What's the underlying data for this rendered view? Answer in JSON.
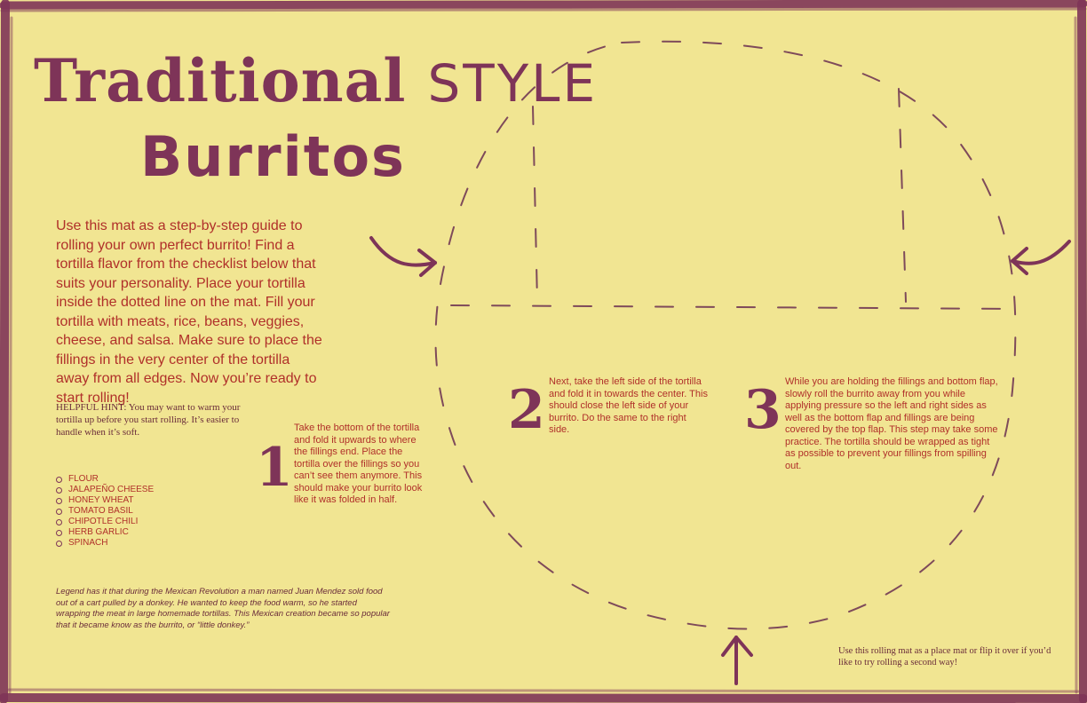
{
  "title": {
    "line1_main": "Traditional",
    "line1_style": "STYLE",
    "line2": "Burritos"
  },
  "intro": "Use this mat as a step-by-step guide to rolling your own perfect burrito! Find a tortilla flavor from the checklist below that suits your personality. Place your tortilla inside the dotted line on the mat. Fill your tortilla with meats, rice, beans, veggies, cheese, and salsa. Make sure to place the fillings in the very center of the tortilla away from all edges. Now you’re ready to start rolling!",
  "hint": "HELPFUL HINT: You may want to warm your tortilla up before you start rolling. It’s easier to handle when it’s soft.",
  "flavors": [
    "FLOUR",
    "JALAPEÑO CHEESE",
    "HONEY WHEAT",
    "TOMATO BASIL",
    "CHIPOTLE CHILI",
    "HERB GARLIC",
    "SPINACH"
  ],
  "legend": "Legend has it that during the Mexican Revolution a man named Juan Mendez sold food out of a cart pulled by a donkey. He wanted to keep the food warm, so he started wrapping the meat in large homemade tortillas. This Mexican creation became so popular that it became know as the burrito, or “little donkey.”",
  "steps": [
    {
      "num": "1",
      "text": "Take the bottom of the tortilla and fold it upwards to where the fillings end. Place the tortilla over the fillings so you can’t see them anymore. This should make your burrito look like it was folded in half."
    },
    {
      "num": "2",
      "text": "Next, take the left side of the tortilla and fold it in towards the center. This should close the left side of your burrito. Do the same to the right side."
    },
    {
      "num": "3",
      "text": "While you are holding the fillings and bottom flap, slowly roll the burrito away from you while applying pressure so the left and right sides as well as the bottom flap and fillings are being covered by the top flap. This step may take some practice. The tortilla should be wrapped as tight as possible to prevent your fillings from spilling out."
    }
  ],
  "footnote": "Use this rolling mat as a place mat or flip it over if you’d like to try rolling a second way!",
  "colors": {
    "background": "#f1e592",
    "border": "#7e3458",
    "text": "#b0302a",
    "dash": "#7e4a5a"
  }
}
